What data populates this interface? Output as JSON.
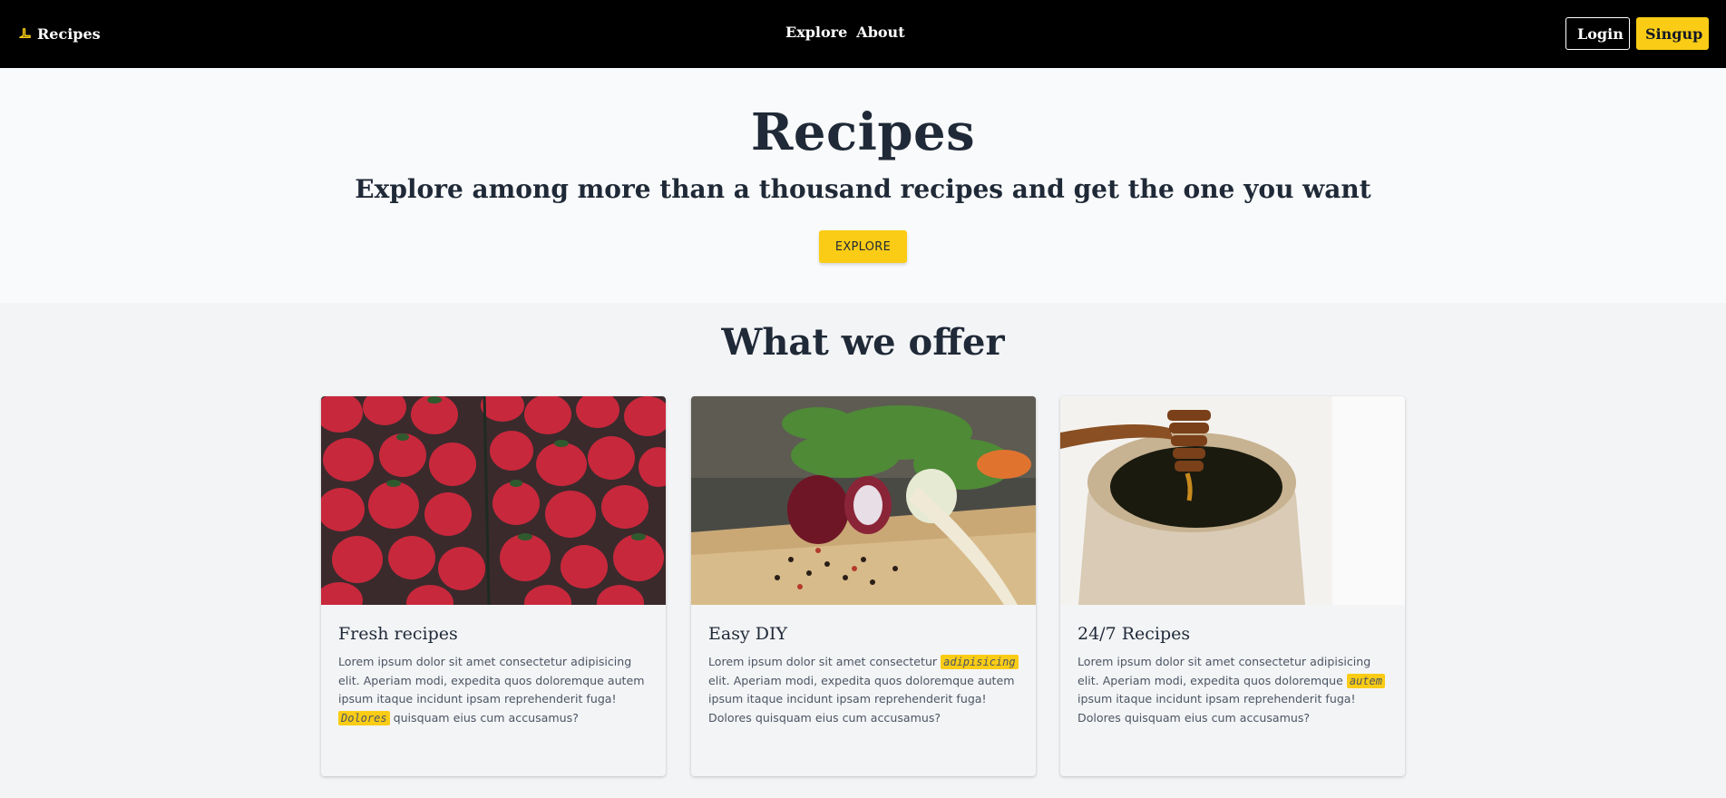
{
  "navbar": {
    "brand": "Recipes",
    "links": [
      "Explore",
      "About"
    ],
    "login_label": "Login",
    "signup_label": "Singup"
  },
  "hero": {
    "title": "Recipes",
    "subtitle": "Explore among more than a thousand recipes and get the one you want",
    "cta_label": "EXPLORE"
  },
  "offer": {
    "title": "What we offer",
    "cards": [
      {
        "title": "Fresh recipes",
        "image": "strawberries-photo",
        "text_before": "Lorem ipsum dolor sit amet consectetur adipisicing elit. Aperiam modi, expedita quos doloremque autem ipsum itaque incidunt ipsam reprehenderit fuga! ",
        "highlight": "Dolores",
        "text_after": " quisquam eius cum accusamus?"
      },
      {
        "title": "Easy DIY",
        "image": "onion-board-photo",
        "text_before": "Lorem ipsum dolor sit amet consectetur ",
        "highlight": "adipisicing",
        "text_after": " elit. Aperiam modi, expedita quos doloremque autem ipsum itaque incidunt ipsam reprehenderit fuga! Dolores quisquam eius cum accusamus?"
      },
      {
        "title": "24/7 Recipes",
        "image": "honey-jar-photo",
        "text_before": "Lorem ipsum dolor sit amet consectetur adipisicing elit. Aperiam modi, expedita quos doloremque ",
        "highlight": "autem",
        "text_after": " ipsum itaque incidunt ipsam reprehenderit fuga! Dolores quisquam eius cum accusamus?"
      }
    ]
  },
  "colors": {
    "accent": "#facc15",
    "nav_bg": "#000000",
    "text": "#1f2937"
  }
}
